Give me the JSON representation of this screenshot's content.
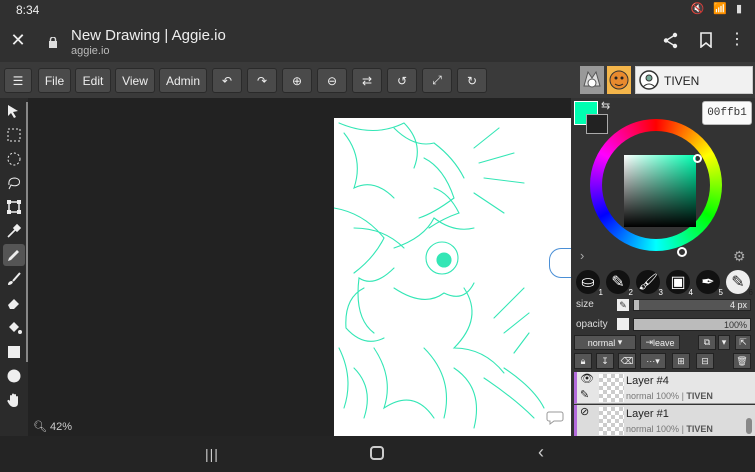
{
  "status": {
    "time": "8:34"
  },
  "browser": {
    "title": "New Drawing | Aggie.io",
    "domain": "aggie.io"
  },
  "toolbar": {
    "file": "File",
    "edit": "Edit",
    "view": "View",
    "admin": "Admin"
  },
  "user": {
    "name": "TIVEN"
  },
  "color": {
    "hex": "00ffb1",
    "primary": "#00ffb1",
    "secondary": "#222222"
  },
  "brush_settings": {
    "size_label": "size",
    "size_value": "4 px",
    "opacity_label": "opacity",
    "opacity_value": "100%",
    "size_fraction": 0.04,
    "opacity_fraction": 1.0
  },
  "layer_controls": {
    "blend": "normal",
    "leave": "leave"
  },
  "layers": [
    {
      "name": "Layer #4",
      "mode": "normal",
      "opacity": "100%",
      "owner": "TIVEN"
    },
    {
      "name": "Layer #1",
      "mode": "normal",
      "opacity": "100%",
      "owner": "TIVEN"
    }
  ],
  "brush_presets": [
    "1",
    "2",
    "3",
    "4",
    "5",
    "6"
  ],
  "zoom": {
    "label": "42%"
  }
}
